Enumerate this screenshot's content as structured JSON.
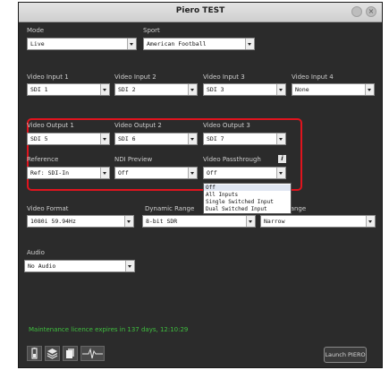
{
  "window": {
    "title": "Piero TEST"
  },
  "mode": {
    "label": "Mode",
    "value": "Live"
  },
  "sport": {
    "label": "Sport",
    "value": "American Football"
  },
  "video_inputs": [
    {
      "label": "Video Input 1",
      "value": "SDI 1"
    },
    {
      "label": "Video Input 2",
      "value": "SDI 2"
    },
    {
      "label": "Video Input 3",
      "value": "SDI 3"
    },
    {
      "label": "Video Input 4",
      "value": "None"
    }
  ],
  "video_outputs": [
    {
      "label": "Video Output 1",
      "value": "SDI 5"
    },
    {
      "label": "Video Output 2",
      "value": "SDI 6"
    },
    {
      "label": "Video Output 3",
      "value": "SDI 7"
    }
  ],
  "reference": {
    "label": "Reference",
    "value": "Ref: SDI-In"
  },
  "ndi_preview": {
    "label": "NDI Preview",
    "value": "Off"
  },
  "video_passthrough": {
    "label": "Video Passthrough",
    "value": "Off",
    "info_glyph": "i",
    "options": [
      "Off",
      "All Inputs",
      "Single Switched Input",
      "Dual Switched Input"
    ]
  },
  "video_format": {
    "label": "Video Format",
    "value": "1080i 59.94Hz"
  },
  "dynamic_range": {
    "label": "Dynamic Range",
    "value": "8-bit SDR"
  },
  "range": {
    "label": "Range",
    "value": "Narrow"
  },
  "audio": {
    "label": "Audio",
    "value": "No Audio"
  },
  "licence_text": "Maintenance licence expires in 137 days, 12:10:29",
  "launch_button": "Launch PIERO",
  "icons": [
    "battery-icon",
    "layers-icon",
    "document-icon",
    "waveform-icon"
  ],
  "colors": {
    "highlight": "#e0141e",
    "licence": "#3fbf3f",
    "background": "#2b2b2b"
  }
}
